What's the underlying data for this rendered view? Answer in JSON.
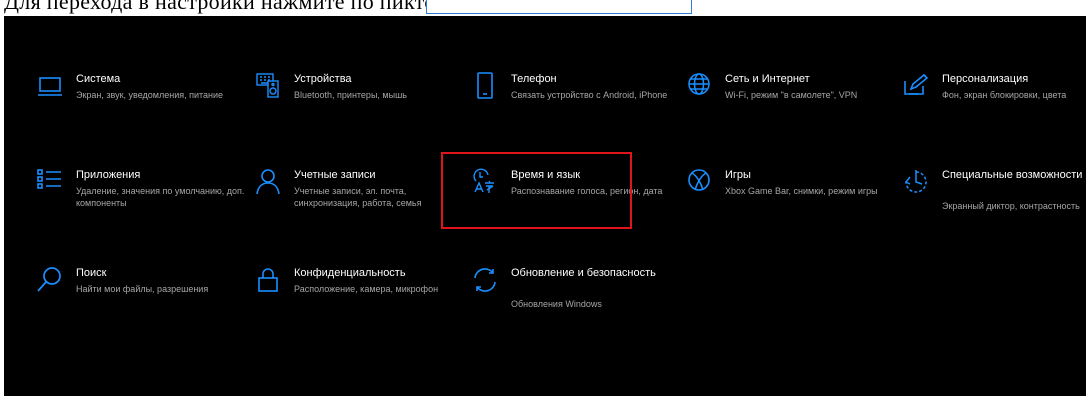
{
  "top_text": "Для перехода в настройки нажмите по пиктограмме:",
  "accent_color": "#1a8fff",
  "highlight_color": "#e0151b",
  "tiles": [
    {
      "id": "system",
      "icon": "monitor-icon",
      "title": "Система",
      "desc": "Экран, звук, уведомления, питание"
    },
    {
      "id": "devices",
      "icon": "keyboard-speaker-icon",
      "title": "Устройства",
      "desc": "Bluetooth, принтеры, мышь"
    },
    {
      "id": "phone",
      "icon": "phone-icon",
      "title": "Телефон",
      "desc": "Связать устройство с Android, iPhone"
    },
    {
      "id": "network",
      "icon": "globe-icon",
      "title": "Сеть и Интернет",
      "desc": "Wi-Fi, режим \"в самолете\", VPN"
    },
    {
      "id": "personalization",
      "icon": "pen-screen-icon",
      "title": "Персонализация",
      "desc": "Фон, экран блокировки, цвета"
    },
    {
      "id": "apps",
      "icon": "apps-list-icon",
      "title": "Приложения",
      "desc": "Удаление, значения по умолчанию, доп. компоненты"
    },
    {
      "id": "accounts",
      "icon": "person-icon",
      "title": "Учетные записи",
      "desc": "Учетные записи, эл. почта, синхронизация, работа, семья"
    },
    {
      "id": "time-language",
      "icon": "time-language-icon",
      "title": "Время и язык",
      "desc": "Распознавание голоса, регион, дата"
    },
    {
      "id": "gaming",
      "icon": "xbox-icon",
      "title": "Игры",
      "desc": "Xbox Game Bar, снимки, режим игры"
    },
    {
      "id": "accessibility",
      "icon": "accessibility-icon",
      "title": "Специальные возможности",
      "desc": "Экранный диктор, контрастность"
    },
    {
      "id": "search",
      "icon": "search-icon",
      "title": "Поиск",
      "desc": "Найти мои файлы, разрешения"
    },
    {
      "id": "privacy",
      "icon": "lock-icon",
      "title": "Конфиденциальность",
      "desc": "Расположение, камера, микрофон"
    },
    {
      "id": "update",
      "icon": "update-sync-icon",
      "title": "Обновление и безопасность",
      "desc": "Обновления Windows"
    }
  ]
}
